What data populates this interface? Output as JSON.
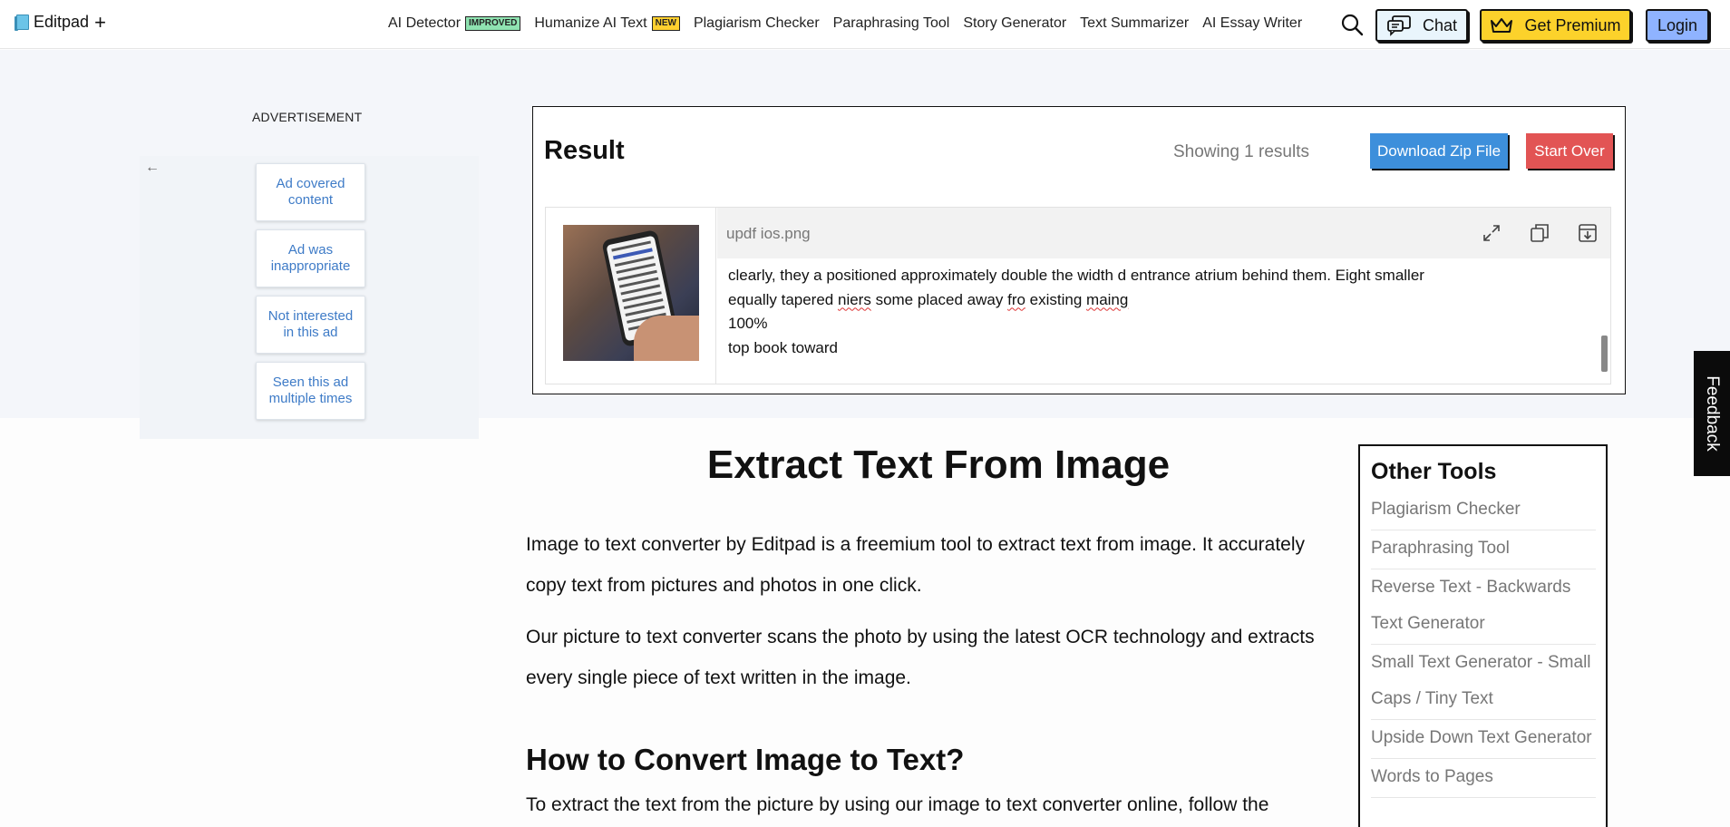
{
  "header": {
    "logo_text": "Editpad",
    "logo_plus": "+",
    "nav": [
      {
        "label": "AI Detector",
        "badge": "IMPROVED"
      },
      {
        "label": "Humanize AI Text",
        "badge": "NEW"
      },
      {
        "label": "Plagiarism Checker"
      },
      {
        "label": "Paraphrasing Tool"
      },
      {
        "label": "Story Generator"
      },
      {
        "label": "Text Summarizer"
      },
      {
        "label": "AI Essay Writer"
      }
    ],
    "chat_label": "Chat",
    "premium_label": "Get Premium",
    "login_label": "Login"
  },
  "ad": {
    "label": "ADVERTISEMENT",
    "options": [
      "Ad covered content",
      "Ad was inappropriate",
      "Not interested in this ad",
      "Seen this ad multiple times"
    ]
  },
  "result": {
    "title": "Result",
    "showing": "Showing 1 results",
    "download_label": "Download Zip File",
    "start_over_label": "Start Over",
    "file_name": "updf ios.png",
    "text_lines": [
      "clearly, they a positioned approximately double the width d entrance atrium behind them. Eight smaller",
      "100%",
      "top book toward"
    ],
    "line2_parts": [
      "equally tapered ",
      "niers",
      " some placed away ",
      "fro",
      " existing ",
      "maing"
    ]
  },
  "feedback_label": "Feedback",
  "article": {
    "title": "Extract Text From Image",
    "para1": "Image to text converter by Editpad is a freemium tool to extract text from image. It accurately copy text from pictures and photos in one click.",
    "para2": "Our picture to text converter scans the photo by using the latest OCR technology and extracts every single piece of text written in the image.",
    "h2": "How to Convert Image to Text?",
    "para3": "To extract the text from the picture by using our image to text converter online, follow the"
  },
  "other_tools": {
    "title": "Other Tools",
    "items": [
      "Plagiarism Checker",
      "Paraphrasing Tool",
      "Reverse Text - Backwards Text Generator",
      "Small Text Generator - Small Caps / Tiny Text",
      "Upside Down Text Generator",
      "Words to Pages"
    ]
  },
  "colors": {
    "chat_bg": "#e9f5fc",
    "premium_bg": "#fcd22b",
    "login_bg": "#8fb3ff",
    "download_bg": "#3d8fdb",
    "start_over_bg": "#e25454",
    "ad_link": "#3e7bc7"
  }
}
